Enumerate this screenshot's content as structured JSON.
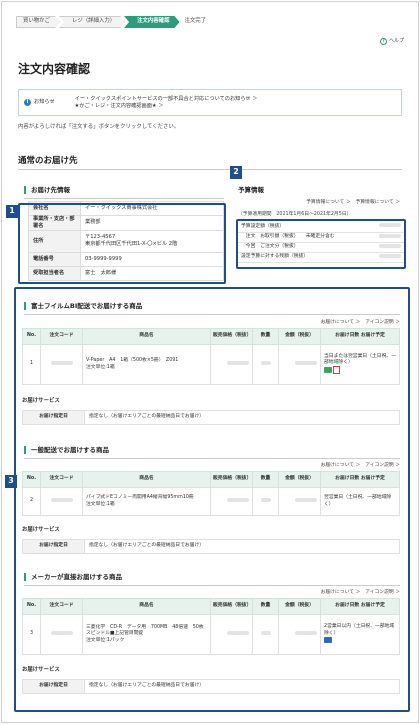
{
  "steps": [
    "買い物かご",
    "レジ（詳細入力）",
    "注文内容確認",
    "注文完了"
  ],
  "help": "ヘルプ",
  "page_title": "注文内容確認",
  "notice": {
    "label": "お知らせ",
    "line1": "イー・クイックスポイントサービスの一部不具合と対応についてのお知らせ ＞",
    "line2": "★かご・レジ・注文内容確認画面★ ＞"
  },
  "instruction": "内容がよろしければ「注文する」ボタンをクリックしてください。",
  "section_title": "通常のお届け先",
  "markers": [
    "1",
    "2",
    "3"
  ],
  "delivery": {
    "title": "お届け先情報",
    "rows": [
      {
        "k": "会社名",
        "v": "イー・クイックス商事株式会社"
      },
      {
        "k": "事業所・支店・部署名",
        "v": "業務部"
      },
      {
        "k": "住所",
        "v": "〒123-4567",
        "v2": "東京都千代田区千代田1-X-〇×ビル 2階"
      },
      {
        "k": "電話番号",
        "v": "03-9999-9999"
      },
      {
        "k": "受取担当者名",
        "v": "富士　太郎様"
      }
    ]
  },
  "budget": {
    "title": "予算情報",
    "links": "予算情報について ＞　予算情報について ＞",
    "period": "（予算適用期間　2021年1月6日～2021年2月5日）",
    "rows": [
      "予算設定額（税抜）",
      "　注文　お取引額（税抜）　　未確定分含む",
      "　今回　ご注文分（税抜）",
      "設定予算に対する残額（税抜）"
    ]
  },
  "sections": [
    {
      "title": "富士フイルムBI配送でお届けする商品",
      "links": "お届けについて ＞　アイコン説明 ＞",
      "headers": [
        "No.",
        "注文コード",
        "商品名",
        "販売価格（税抜）",
        "数量",
        "金額（税抜）",
        "お届け日数 お届け予定"
      ],
      "row": {
        "no": "1",
        "name": "V-Paper　A4　1箱（500枚×5冊）　Z091",
        "unit": "注文単位:1箱",
        "delivery": "当日または翌営業日（土日祝、一部地域除く）"
      },
      "service_title": "お届けサービス",
      "service_key": "お届け指定日",
      "service_val": "指定なし（お届けエリアごとの最短納品日でお届け）"
    },
    {
      "title": "一般配送でお届けする商品",
      "links": "お届けについて ＞　アイコン説明 ＞",
      "headers": [
        "No.",
        "注文コード",
        "商品名",
        "販売価格（税抜）",
        "数量",
        "金額（税抜）",
        "お届け日数 お届け予定"
      ],
      "row": {
        "no": "2",
        "name": "パイプ式ドEコノミー両開用A4縦背幅95mm10冊",
        "unit": "注文単位:1箱",
        "delivery": "翌営業日（土日祝、一部地域除く）"
      },
      "service_title": "お届けサービス",
      "service_key": "お届け指定日",
      "service_val": "指定なし（お届けエリアごとの最短納品日でお届け）"
    },
    {
      "title": "メーカーが直接お届けする商品",
      "links": "お届けについて ＞　アイコン説明 ＞",
      "headers": [
        "No.",
        "注文コード",
        "商品名",
        "販売価格（税抜）",
        "数量",
        "金額（税抜）",
        "お届け日数 お届け予定"
      ],
      "row": {
        "no": "3",
        "name": "三菱化学　CD-R　データ用　700MB　48倍速　50枚スピンドル■上記管目閲錠",
        "unit": "注文単位:1パック",
        "delivery": "2営業日以内（土日祝、一部地域除く）"
      },
      "service_title": "お届けサービス",
      "service_key": "お届け指定日",
      "service_val": "指定なし（お届けエリアごとの最短納品日でお届け）"
    }
  ]
}
